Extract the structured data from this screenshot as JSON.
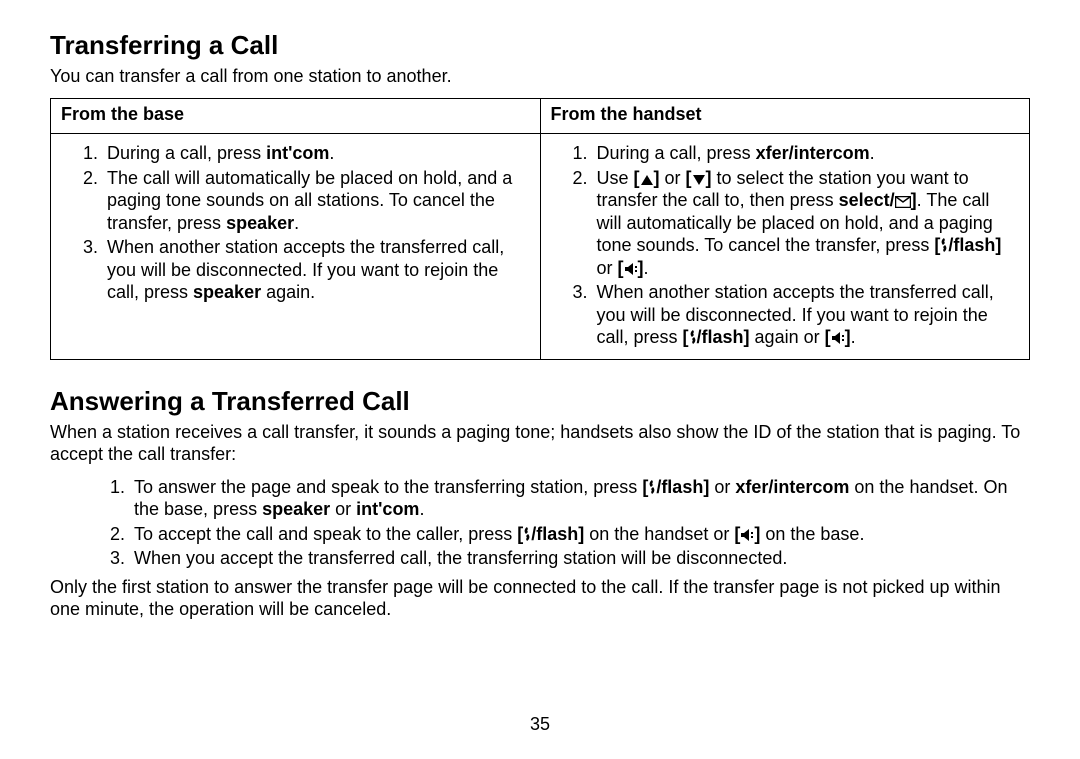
{
  "section1": {
    "heading": "Transferring a Call",
    "intro": "You can transfer a call from one station to another.",
    "table": {
      "col1_header": "From the base",
      "col2_header": "From the handset",
      "base": {
        "item1_a": "During a call, press ",
        "item1_b": "int'com",
        "item1_c": ".",
        "item2_a": "The call will automatically be placed on hold, and a paging tone sounds on all stations. To cancel the transfer, press ",
        "item2_b": "speaker",
        "item2_c": ".",
        "item3_a": "When another station accepts the transferred call, you will be disconnected. If you want to rejoin the call, press ",
        "item3_b": "speaker",
        "item3_c": " again."
      },
      "handset": {
        "item1_a": "During a call, press ",
        "item1_b": "xfer/intercom",
        "item1_c": ".",
        "item2_a": "Use ",
        "item2_b": " or ",
        "item2_c": " to select the station you want to transfer the call to, then press ",
        "item2_d": "select/",
        "item2_e": ". The call will automatically be placed on hold, and a paging tone sounds. To cancel the transfer, press ",
        "item2_f": "/flash",
        "item2_g": " or ",
        "item2_h": ".",
        "item3_a": "When another station accepts the transferred call, you will be disconnected. If you want to rejoin the call, press ",
        "item3_b": "/flash",
        "item3_c": " again or ",
        "item3_d": "."
      }
    }
  },
  "section2": {
    "heading": "Answering a Transferred Call",
    "intro": "When a station receives a call transfer, it sounds a paging tone; handsets also show the ID of the station that is paging. To accept the call transfer:",
    "list": {
      "item1_a": "To answer the page and speak to the transferring station, press ",
      "item1_b": "/flash",
      "item1_c": " or ",
      "item1_d": "xfer/intercom",
      "item1_e": " on the handset. On the base, press ",
      "item1_f": "speaker",
      "item1_g": " or ",
      "item1_h": "int'com",
      "item1_i": ".",
      "item2_a": "To accept the call and speak to the caller, press ",
      "item2_b": "/flash",
      "item2_c": "  on the handset or ",
      "item2_d": " on the base.",
      "item3": "When you accept the transferred call, the transferring station will be disconnected."
    },
    "footnote": "Only the first station to answer the transfer page will be connected to the call. If the transfer page is not picked up within one minute, the operation will be canceled."
  },
  "page_number": "35"
}
